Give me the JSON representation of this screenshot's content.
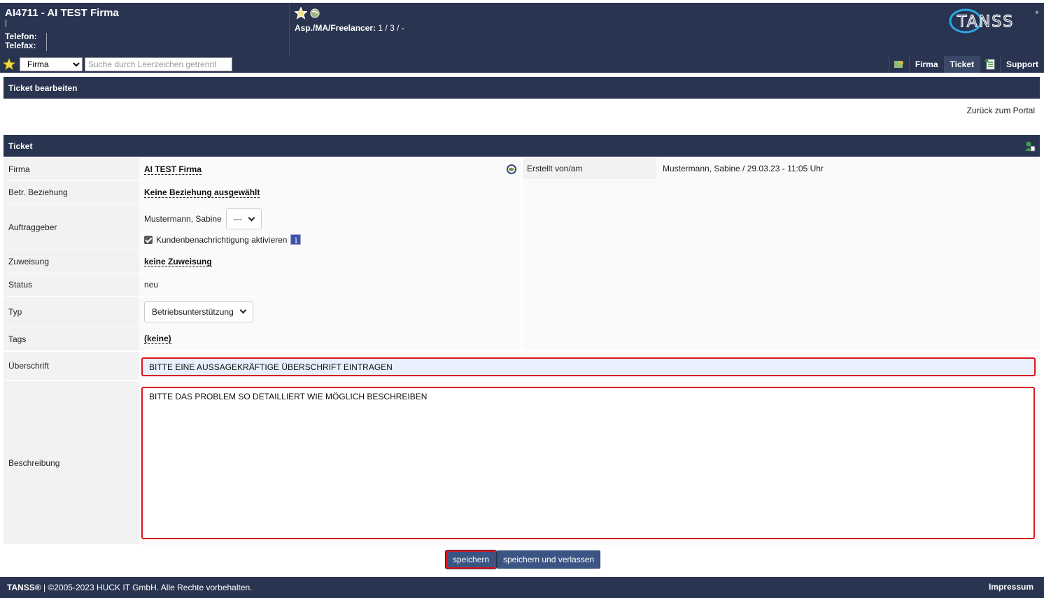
{
  "header": {
    "title": "AI4711 - AI TEST Firma",
    "pipe": "|",
    "phone_label": "Telefon:",
    "fax_label": "Telefax:",
    "asp_label": "Asp./MA/Freelancer:",
    "asp_value": "1 / 3 / -",
    "logo_text": "TANSS"
  },
  "navbar": {
    "search_scope": "Firma",
    "search_placeholder": "Suche durch Leerzeichen getrennt",
    "tabs": [
      "Firma",
      "Ticket",
      "Support"
    ],
    "active_tab": "Ticket"
  },
  "section_edit": {
    "title": "Ticket bearbeiten",
    "back_link": "Zurück zum Portal"
  },
  "section_ticket": {
    "title": "Ticket",
    "fields": {
      "firma_label": "Firma",
      "firma_value": "AI TEST Firma",
      "beziehung_label": "Betr. Beziehung",
      "beziehung_value": "Keine Beziehung ausgewählt",
      "auftraggeber_label": "Auftraggeber",
      "auftraggeber_value": "Mustermann, Sabine",
      "auftraggeber_select": "---",
      "notify_label": "Kundenbenachrichtigung aktivieren",
      "notify_checked": true,
      "zuweisung_label": "Zuweisung",
      "zuweisung_value": "keine Zuweisung",
      "status_label": "Status",
      "status_value": "neu",
      "typ_label": "Typ",
      "typ_value": "Betriebsunterstützung",
      "tags_label": "Tags",
      "tags_value": "(keine)",
      "created_label": "Erstellt von/am",
      "created_value": "Mustermann, Sabine / 29.03.23 - 11:05 Uhr",
      "headline_label": "Überschrift",
      "headline_value": "BITTE EINE AUSSAGEKRÄFTIGE ÜBERSCHRIFT EINTRAGEN",
      "description_label": "Beschreibung",
      "description_value": "BITTE DAS PROBLEM SO DETAILLIERT WIE MÖGLICH BESCHREIBEN"
    }
  },
  "buttons": {
    "save": "speichern",
    "save_exit": "speichern und verlassen"
  },
  "footer": {
    "brand": "TANSS®",
    "copyright": "| ©2005-2023 HUCK IT GmbH. Alle Rechte vorbehalten.",
    "impressum": "Impressum"
  }
}
